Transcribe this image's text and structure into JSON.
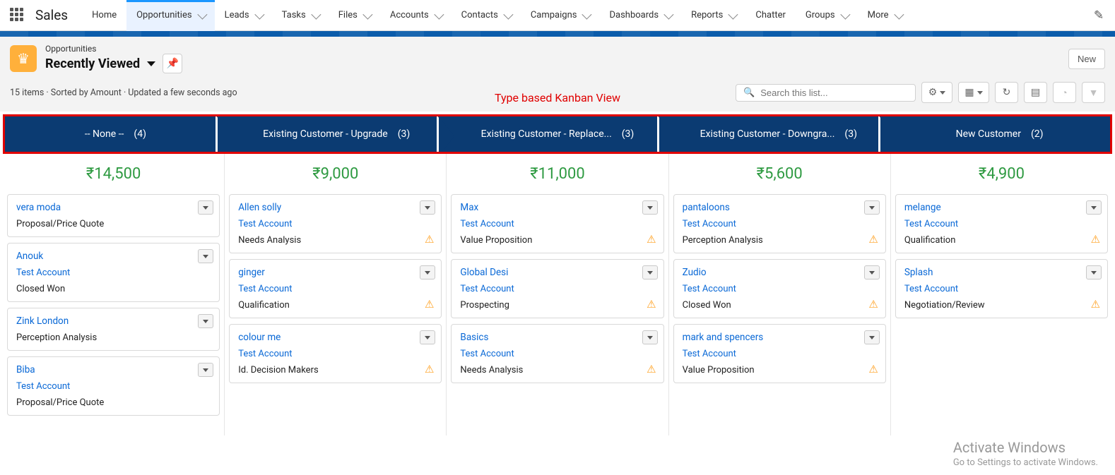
{
  "appName": "Sales",
  "nav": {
    "items": [
      {
        "label": "Home",
        "dropdown": false
      },
      {
        "label": "Opportunities",
        "dropdown": true,
        "active": true
      },
      {
        "label": "Leads",
        "dropdown": true
      },
      {
        "label": "Tasks",
        "dropdown": true
      },
      {
        "label": "Files",
        "dropdown": true
      },
      {
        "label": "Accounts",
        "dropdown": true
      },
      {
        "label": "Contacts",
        "dropdown": true
      },
      {
        "label": "Campaigns",
        "dropdown": true
      },
      {
        "label": "Dashboards",
        "dropdown": true
      },
      {
        "label": "Reports",
        "dropdown": true
      },
      {
        "label": "Chatter",
        "dropdown": false
      },
      {
        "label": "Groups",
        "dropdown": true
      },
      {
        "label": "More",
        "dropdown": true
      }
    ]
  },
  "header": {
    "objectLabel": "Opportunities",
    "viewName": "Recently Viewed",
    "newButton": "New",
    "meta": "15 items · Sorted by Amount · Updated a few seconds ago",
    "annotation": "Type based Kanban View",
    "searchPlaceholder": "Search this list..."
  },
  "stages": [
    {
      "label": "-- None --",
      "count": "(4)"
    },
    {
      "label": "Existing Customer - Upgrade",
      "count": "(3)"
    },
    {
      "label": "Existing Customer - Replace...",
      "count": "(3)"
    },
    {
      "label": "Existing Customer - Downgra...",
      "count": "(3)"
    },
    {
      "label": "New Customer",
      "count": "(2)"
    }
  ],
  "columns": [
    {
      "amount": "₹14,500",
      "cards": [
        {
          "title": "vera moda",
          "account": "",
          "stage": "Proposal/Price Quote",
          "warn": false
        },
        {
          "title": "Anouk",
          "account": "Test Account",
          "stage": "Closed Won",
          "warn": false
        },
        {
          "title": "Zink London",
          "account": "",
          "stage": "Perception Analysis",
          "warn": false
        },
        {
          "title": "Biba",
          "account": "Test Account",
          "stage": "Proposal/Price Quote",
          "warn": false
        }
      ]
    },
    {
      "amount": "₹9,000",
      "cards": [
        {
          "title": "Allen solly",
          "account": "Test Account",
          "stage": "Needs Analysis",
          "warn": true
        },
        {
          "title": "ginger",
          "account": "Test Account",
          "stage": "Qualification",
          "warn": true
        },
        {
          "title": "colour me",
          "account": "Test Account",
          "stage": "Id. Decision Makers",
          "warn": true
        }
      ]
    },
    {
      "amount": "₹11,000",
      "cards": [
        {
          "title": "Max",
          "account": "Test Account",
          "stage": "Value Proposition",
          "warn": true
        },
        {
          "title": "Global Desi",
          "account": "Test Account",
          "stage": "Prospecting",
          "warn": true
        },
        {
          "title": "Basics",
          "account": "Test Account",
          "stage": "Needs Analysis",
          "warn": true
        }
      ]
    },
    {
      "amount": "₹5,600",
      "cards": [
        {
          "title": "pantaloons",
          "account": "Test Account",
          "stage": "Perception Analysis",
          "warn": true
        },
        {
          "title": "Zudio",
          "account": "Test Account",
          "stage": "Closed Won",
          "warn": true
        },
        {
          "title": "mark and spencers",
          "account": "Test Account",
          "stage": "Value Proposition",
          "warn": true
        }
      ]
    },
    {
      "amount": "₹4,900",
      "cards": [
        {
          "title": "melange",
          "account": "Test Account",
          "stage": "Qualification",
          "warn": true
        },
        {
          "title": "Splash",
          "account": "Test Account",
          "stage": "Negotiation/Review",
          "warn": true
        }
      ]
    }
  ],
  "watermark": {
    "line1": "Activate Windows",
    "line2": "Go to Settings to activate Windows."
  }
}
